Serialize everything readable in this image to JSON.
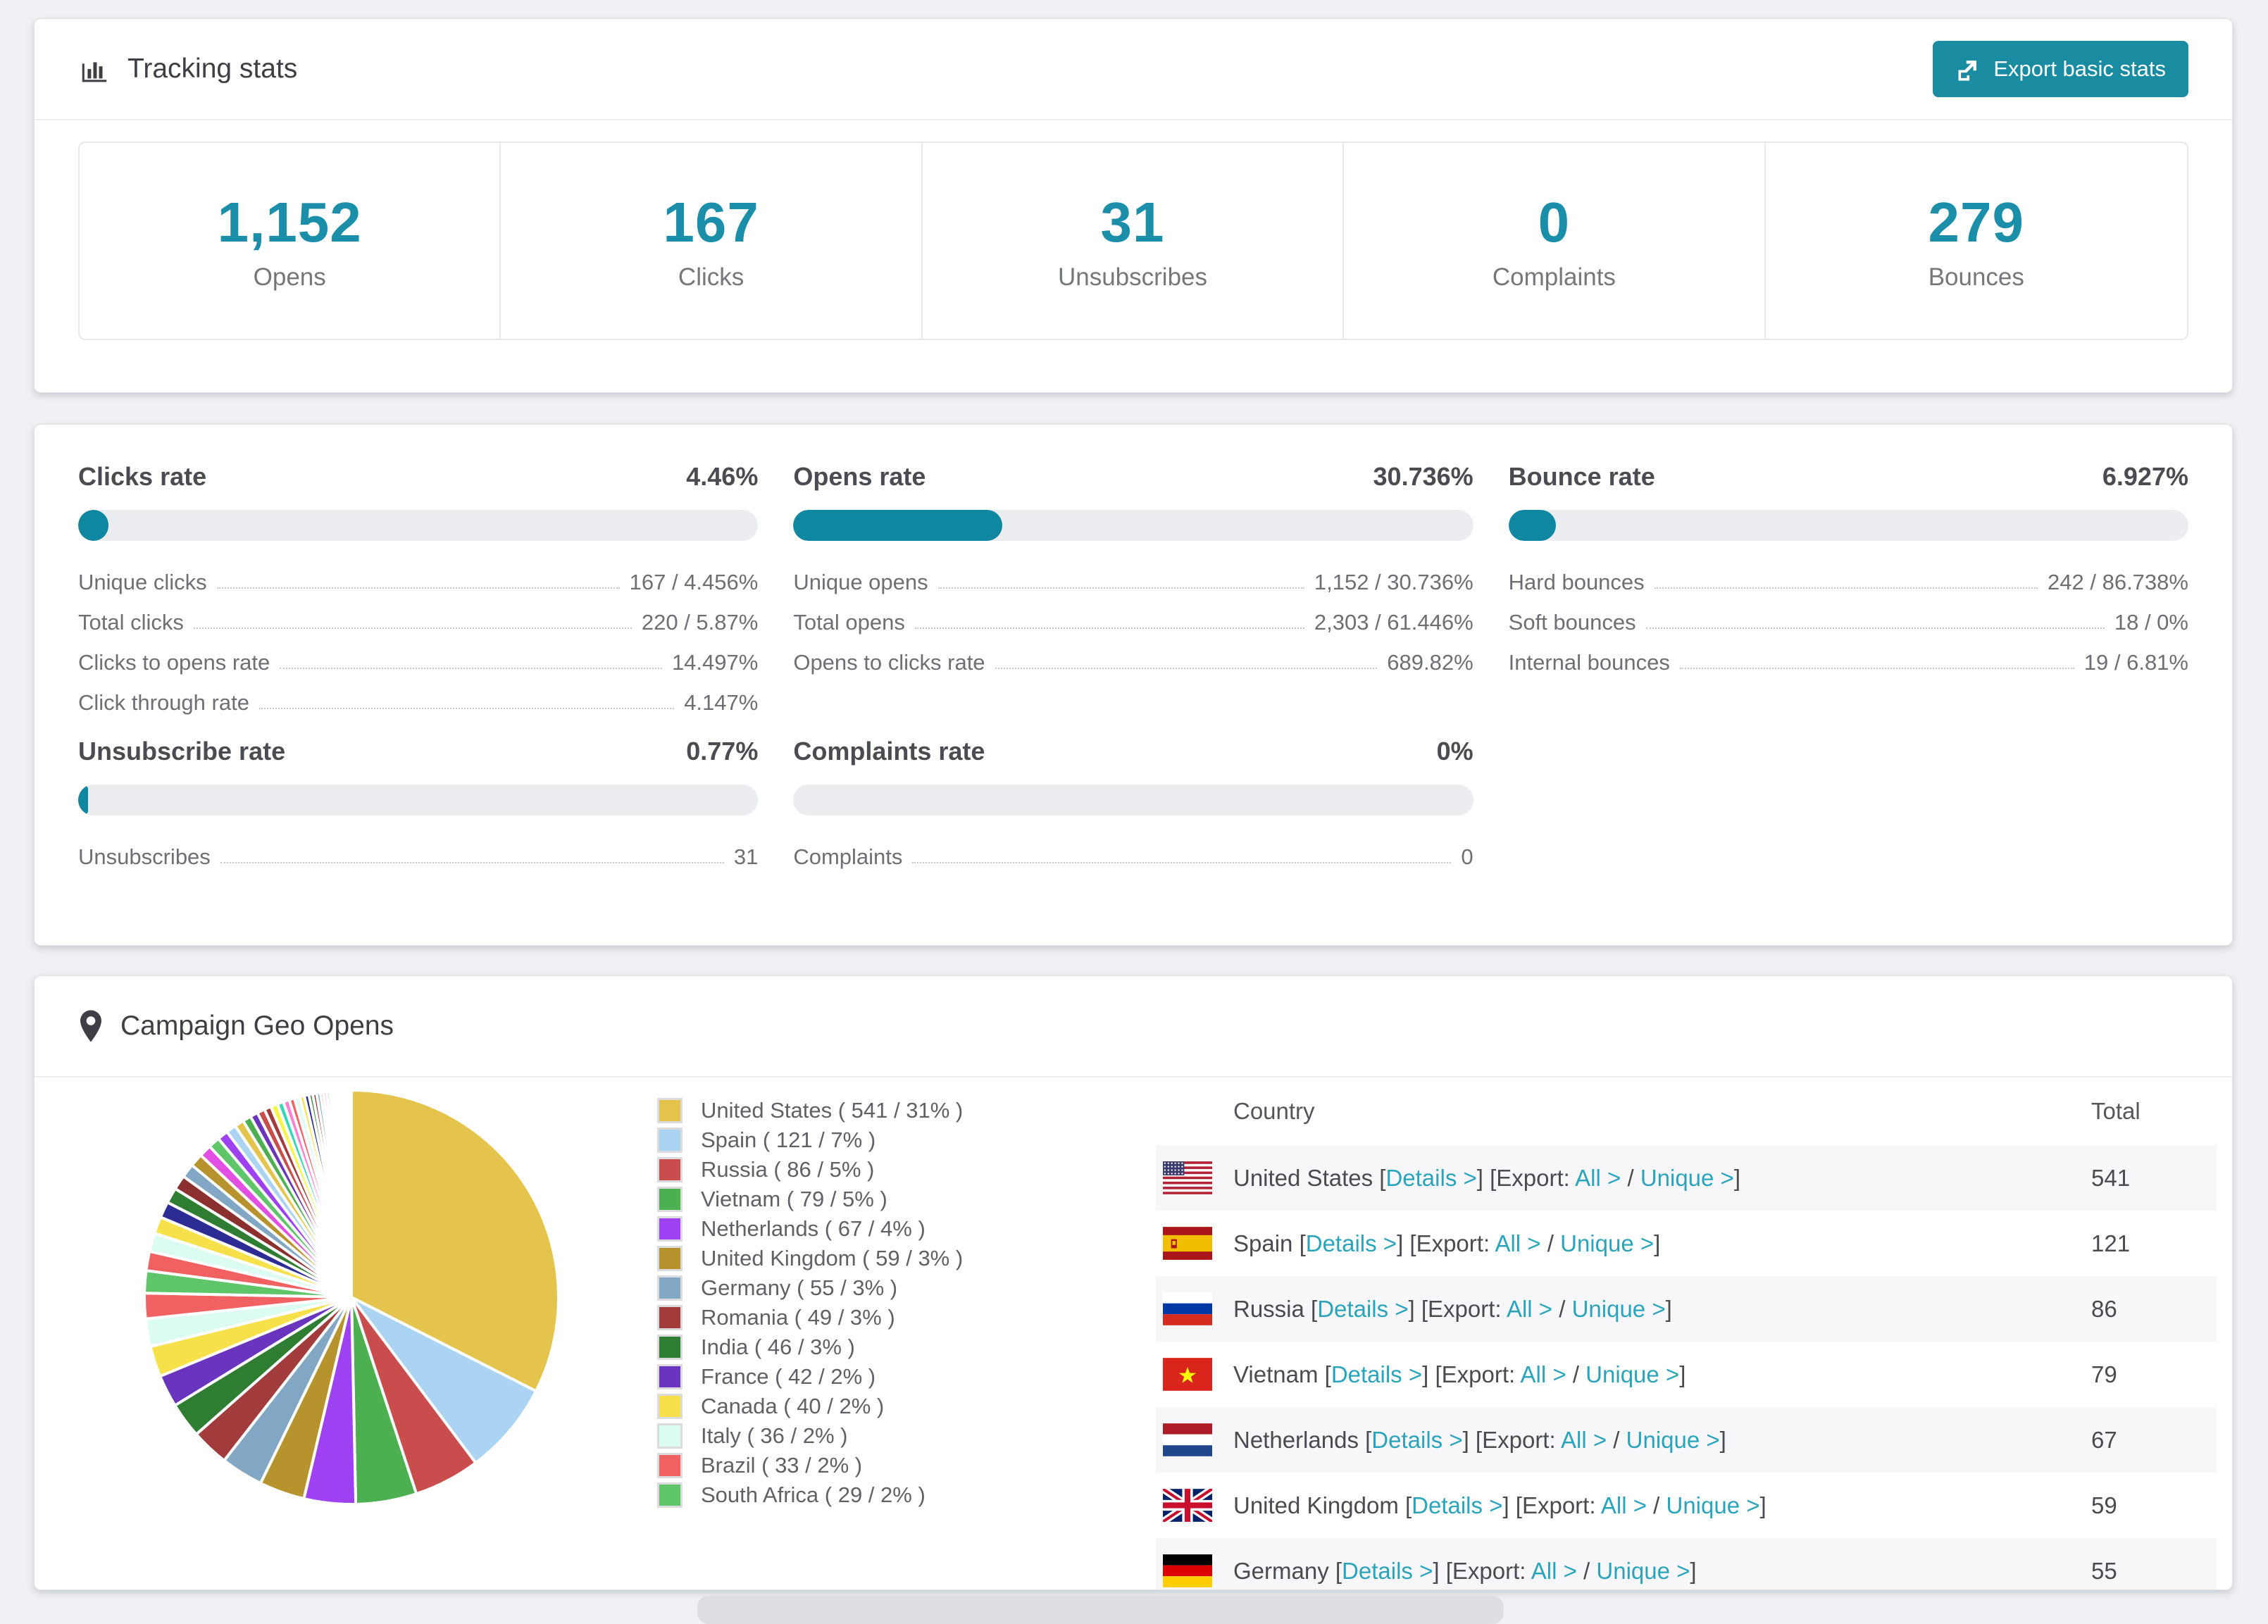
{
  "colors": {
    "accent_teal": "#1a8ca1",
    "number_teal": "#1b8fa9",
    "link_teal": "#2aa4bc",
    "bar_fill": "#0f87a0",
    "bar_track": "#ebedf0",
    "page_bg": "#f0f1f4",
    "row_shade": "#f7f7f9"
  },
  "tracking": {
    "title": "Tracking stats",
    "export_button_label": "Export basic stats",
    "stats": [
      {
        "value": "1,152",
        "label": "Opens"
      },
      {
        "value": "167",
        "label": "Clicks"
      },
      {
        "value": "31",
        "label": "Unsubscribes"
      },
      {
        "value": "0",
        "label": "Complaints"
      },
      {
        "value": "279",
        "label": "Bounces"
      }
    ]
  },
  "rates": [
    {
      "title": "Clicks rate",
      "value": "4.46%",
      "percent": 4.46,
      "rows": [
        [
          "Unique clicks",
          "167 / 4.456%"
        ],
        [
          "Total clicks",
          "220 / 5.87%"
        ],
        [
          "Clicks to opens rate",
          "14.497%"
        ],
        [
          "Click through rate",
          "4.147%"
        ]
      ]
    },
    {
      "title": "Opens rate",
      "value": "30.736%",
      "percent": 30.736,
      "rows": [
        [
          "Unique opens",
          "1,152 / 30.736%"
        ],
        [
          "Total opens",
          "2,303 / 61.446%"
        ],
        [
          "Opens to clicks rate",
          "689.82%"
        ]
      ]
    },
    {
      "title": "Bounce rate",
      "value": "6.927%",
      "percent": 6.927,
      "rows": [
        [
          "Hard bounces",
          "242 / 86.738%"
        ],
        [
          "Soft bounces",
          "18 / 0%"
        ],
        [
          "Internal bounces",
          "19 / 6.81%"
        ]
      ]
    },
    {
      "title": "Unsubscribe rate",
      "value": "0.77%",
      "percent": 0.77,
      "rows": [
        [
          "Unsubscribes",
          "31"
        ]
      ]
    },
    {
      "title": "Complaints rate",
      "value": "0%",
      "percent": 0,
      "rows": [
        [
          "Complaints",
          "0"
        ]
      ]
    }
  ],
  "geo": {
    "title": "Campaign Geo Opens",
    "table_headers": {
      "country": "Country",
      "total": "Total"
    },
    "link_labels": {
      "details": "Details >",
      "export_prefix": "Export:",
      "all": "All >",
      "unique": "Unique >"
    },
    "rows": [
      {
        "country": "United States",
        "flag": "us",
        "total": "541"
      },
      {
        "country": "Spain",
        "flag": "es",
        "total": "121"
      },
      {
        "country": "Russia",
        "flag": "ru",
        "total": "86"
      },
      {
        "country": "Vietnam",
        "flag": "vn",
        "total": "79"
      },
      {
        "country": "Netherlands",
        "flag": "nl",
        "total": "67"
      },
      {
        "country": "United Kingdom",
        "flag": "gb",
        "total": "59"
      },
      {
        "country": "Germany",
        "flag": "de",
        "total": "55",
        "partial": true
      }
    ]
  },
  "chart_data": {
    "type": "pie",
    "title": "Campaign Geo Opens",
    "legend_position": "right",
    "start_angle_deg": -90,
    "direction": "clockwise",
    "slices": [
      {
        "label": "United States",
        "value": 541,
        "pct": "31",
        "color": "#E4C44C"
      },
      {
        "label": "Spain",
        "value": 121,
        "pct": "7",
        "color": "#ABD3F2"
      },
      {
        "label": "Russia",
        "value": 86,
        "pct": "5",
        "color": "#C94D4D"
      },
      {
        "label": "Vietnam",
        "value": 79,
        "pct": "5",
        "color": "#4CAF50"
      },
      {
        "label": "Netherlands",
        "value": 67,
        "pct": "4",
        "color": "#9D41F2"
      },
      {
        "label": "United Kingdom",
        "value": 59,
        "pct": "3",
        "color": "#B6932C"
      },
      {
        "label": "Germany",
        "value": 55,
        "pct": "3",
        "color": "#82A7C4"
      },
      {
        "label": "Romania",
        "value": 49,
        "pct": "3",
        "color": "#A23C3C"
      },
      {
        "label": "India",
        "value": 46,
        "pct": "3",
        "color": "#2E7D32"
      },
      {
        "label": "France",
        "value": 42,
        "pct": "2",
        "color": "#6A35BE"
      },
      {
        "label": "Canada",
        "value": 40,
        "pct": "2",
        "color": "#F7E14B"
      },
      {
        "label": "Italy",
        "value": 36,
        "pct": "2",
        "color": "#DCFCF3"
      },
      {
        "label": "Brazil",
        "value": 33,
        "pct": "2",
        "color": "#F26161"
      },
      {
        "label": "South Africa",
        "value": 29,
        "pct": "2",
        "color": "#5FC569"
      }
    ],
    "other_slices_values": [
      25,
      24,
      22,
      21,
      20,
      19,
      18,
      17,
      16,
      15,
      14,
      13,
      12,
      11,
      10,
      10,
      9,
      9,
      8,
      8,
      7,
      7,
      6,
      6,
      5,
      5,
      5,
      4,
      4,
      4,
      3,
      3,
      3,
      3,
      2,
      2,
      2,
      2,
      2,
      1,
      1,
      1,
      1,
      1,
      1
    ],
    "other_slices_palette": [
      "#F26161",
      "#DCFCF3",
      "#F7E14B",
      "#2C2C94",
      "#2E7D32",
      "#8C2F2F",
      "#82A7C4",
      "#B6932C",
      "#E24FE2",
      "#5FC569",
      "#9D41F2",
      "#ABD3F2",
      "#E4C44C",
      "#4CAF50",
      "#6A35BE",
      "#C94D4D",
      "#A23C3C",
      "#F5F54C",
      "#36D7B7",
      "#FF7FD4"
    ]
  }
}
